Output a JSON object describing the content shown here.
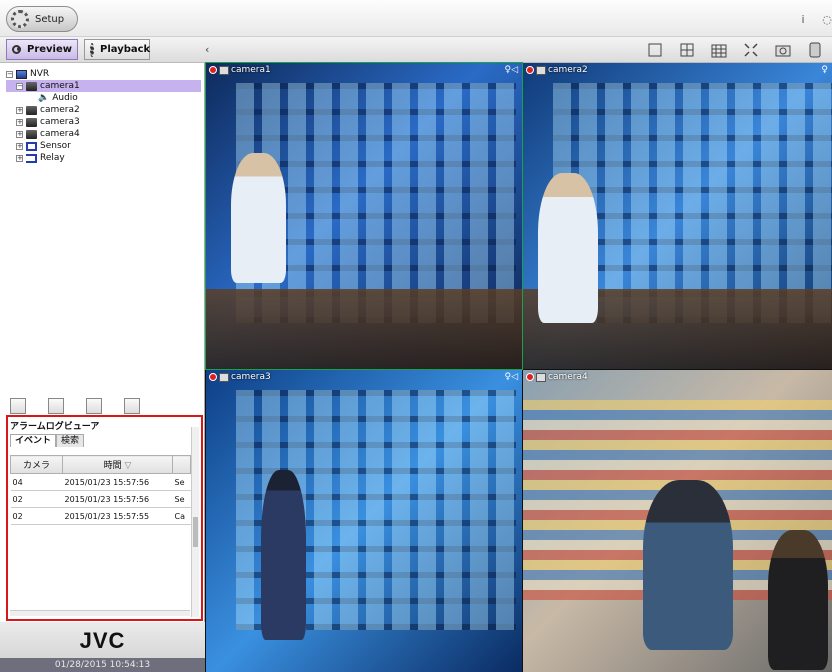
{
  "topbar": {
    "setup_label": "Setup"
  },
  "modes": {
    "preview_label": "Preview",
    "playback_label": "Playback"
  },
  "tree": {
    "root": "NVR",
    "items": [
      {
        "label": "camera1",
        "child": "Audio"
      },
      {
        "label": "camera2"
      },
      {
        "label": "camera3"
      },
      {
        "label": "camera4"
      },
      {
        "label": "Sensor"
      },
      {
        "label": "Relay"
      }
    ]
  },
  "alarm_log": {
    "title": "アラームログビューア",
    "tabs": [
      "イベント",
      "検索"
    ],
    "columns": [
      "カメラ",
      "時間"
    ],
    "rows": [
      {
        "camera": "04",
        "time": "2015/01/23 15:57:56",
        "type": "Se"
      },
      {
        "camera": "02",
        "time": "2015/01/23 15:57:56",
        "type": "Se"
      },
      {
        "camera": "02",
        "time": "2015/01/23 15:57:55",
        "type": "Ca"
      }
    ]
  },
  "brand": {
    "logo": "JVC",
    "datetime": "01/28/2015 10:54:13"
  },
  "tiles": [
    {
      "label": "camera1"
    },
    {
      "label": "camera2"
    },
    {
      "label": "camera3"
    },
    {
      "label": "camera4"
    }
  ]
}
